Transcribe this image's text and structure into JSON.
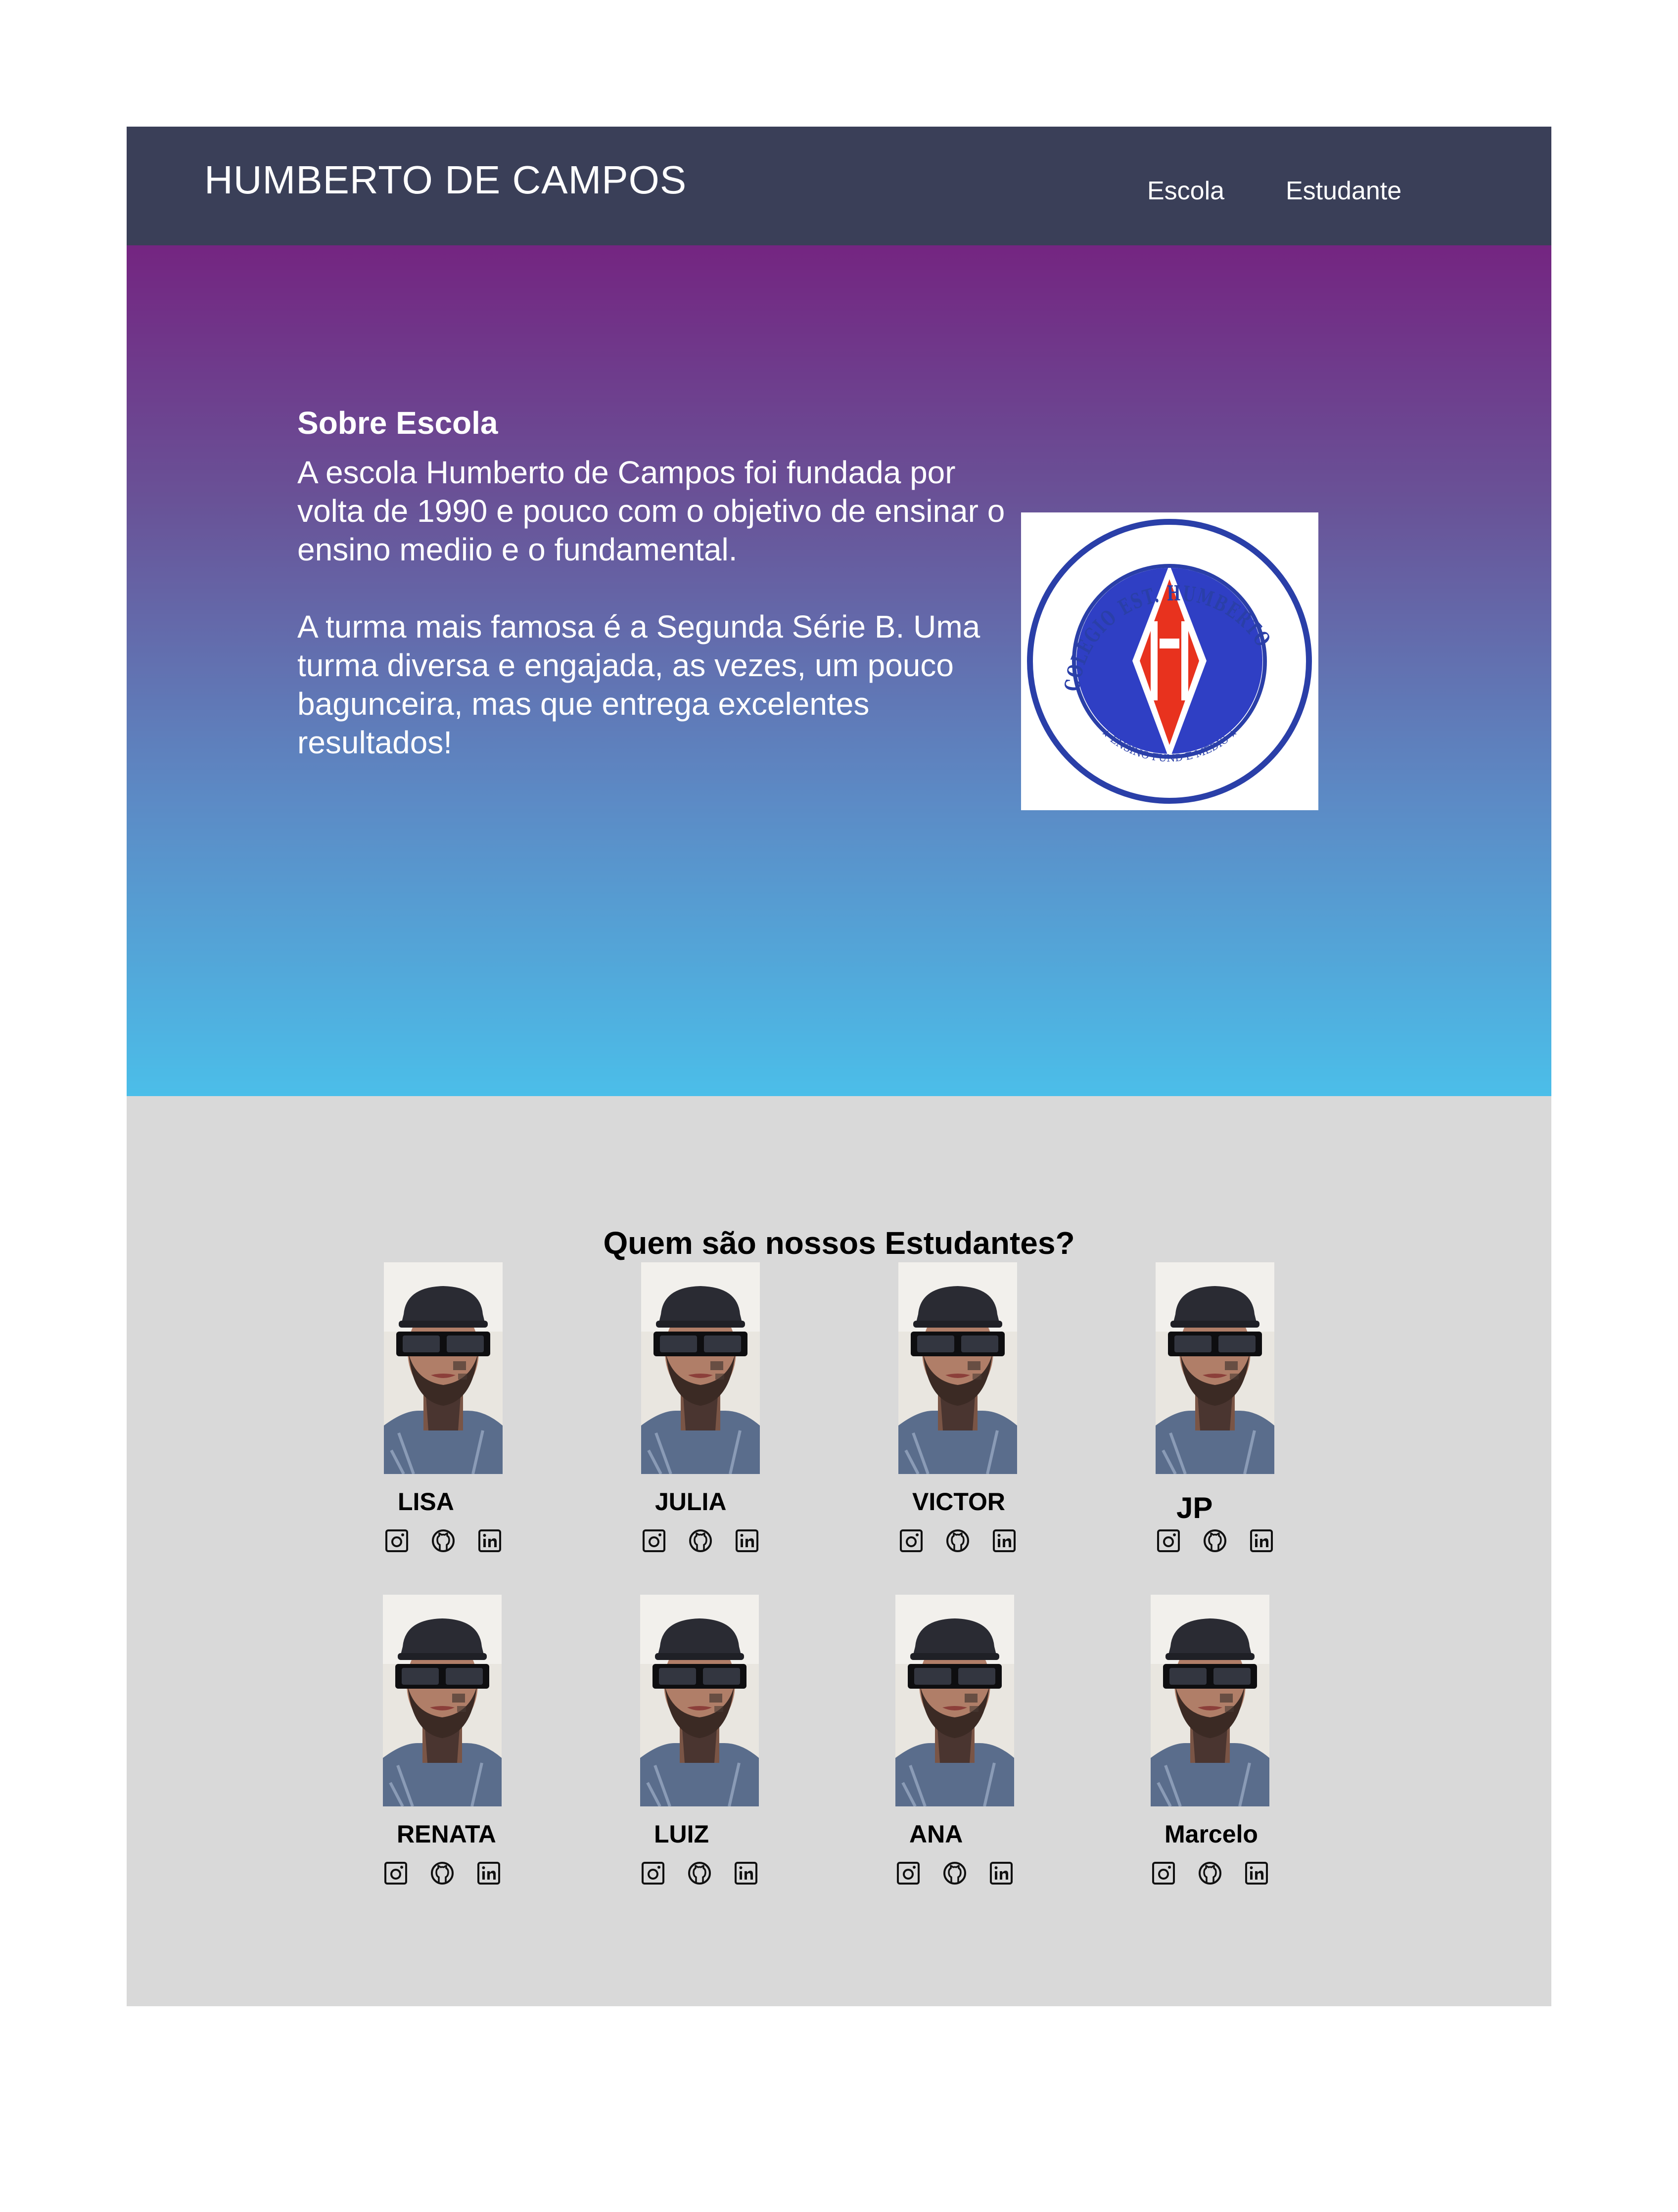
{
  "header": {
    "title": "HUMBERTO DE CAMPOS",
    "nav": [
      {
        "label": "Escola"
      },
      {
        "label": "Estudante"
      }
    ]
  },
  "about": {
    "heading": "Sobre Escola",
    "paragraph1": "A escola Humberto de Campos foi fundada por volta de 1990 e pouco com o objetivo de ensinar o ensino mediio e o fundamental.",
    "paragraph2": "A turma mais famosa é a Segunda Série B. Uma turma diversa e engajada, as vezes, um pouco bagunceira, mas que entrega excelentes resultados!",
    "logo": {
      "ring_text_top": "COLÉGIO EST. HUMBERTO DE CAMPOS",
      "ring_text_bottom": "★ ENSINO FUND E MÉDIO ★",
      "colors": {
        "ring": "#2a3fa8",
        "blue": "#2f3fc4",
        "red": "#e8321e"
      }
    }
  },
  "students": {
    "title": "Quem são nossos Estudantes?",
    "social_icons": [
      "instagram-icon",
      "github-icon",
      "linkedin-icon"
    ],
    "list": [
      {
        "name": "LISA"
      },
      {
        "name": "JULIA"
      },
      {
        "name": "VICTOR"
      },
      {
        "name": "JP"
      },
      {
        "name": "RENATA"
      },
      {
        "name": "LUIZ"
      },
      {
        "name": "ANA"
      },
      {
        "name": "Marcelo"
      }
    ]
  },
  "colors": {
    "navbar": "#3a3f58",
    "hero_gradient": [
      "#742581",
      "#695297",
      "#5c8ac5",
      "#4bbee9"
    ],
    "students_bg": "#d9d9d9"
  }
}
